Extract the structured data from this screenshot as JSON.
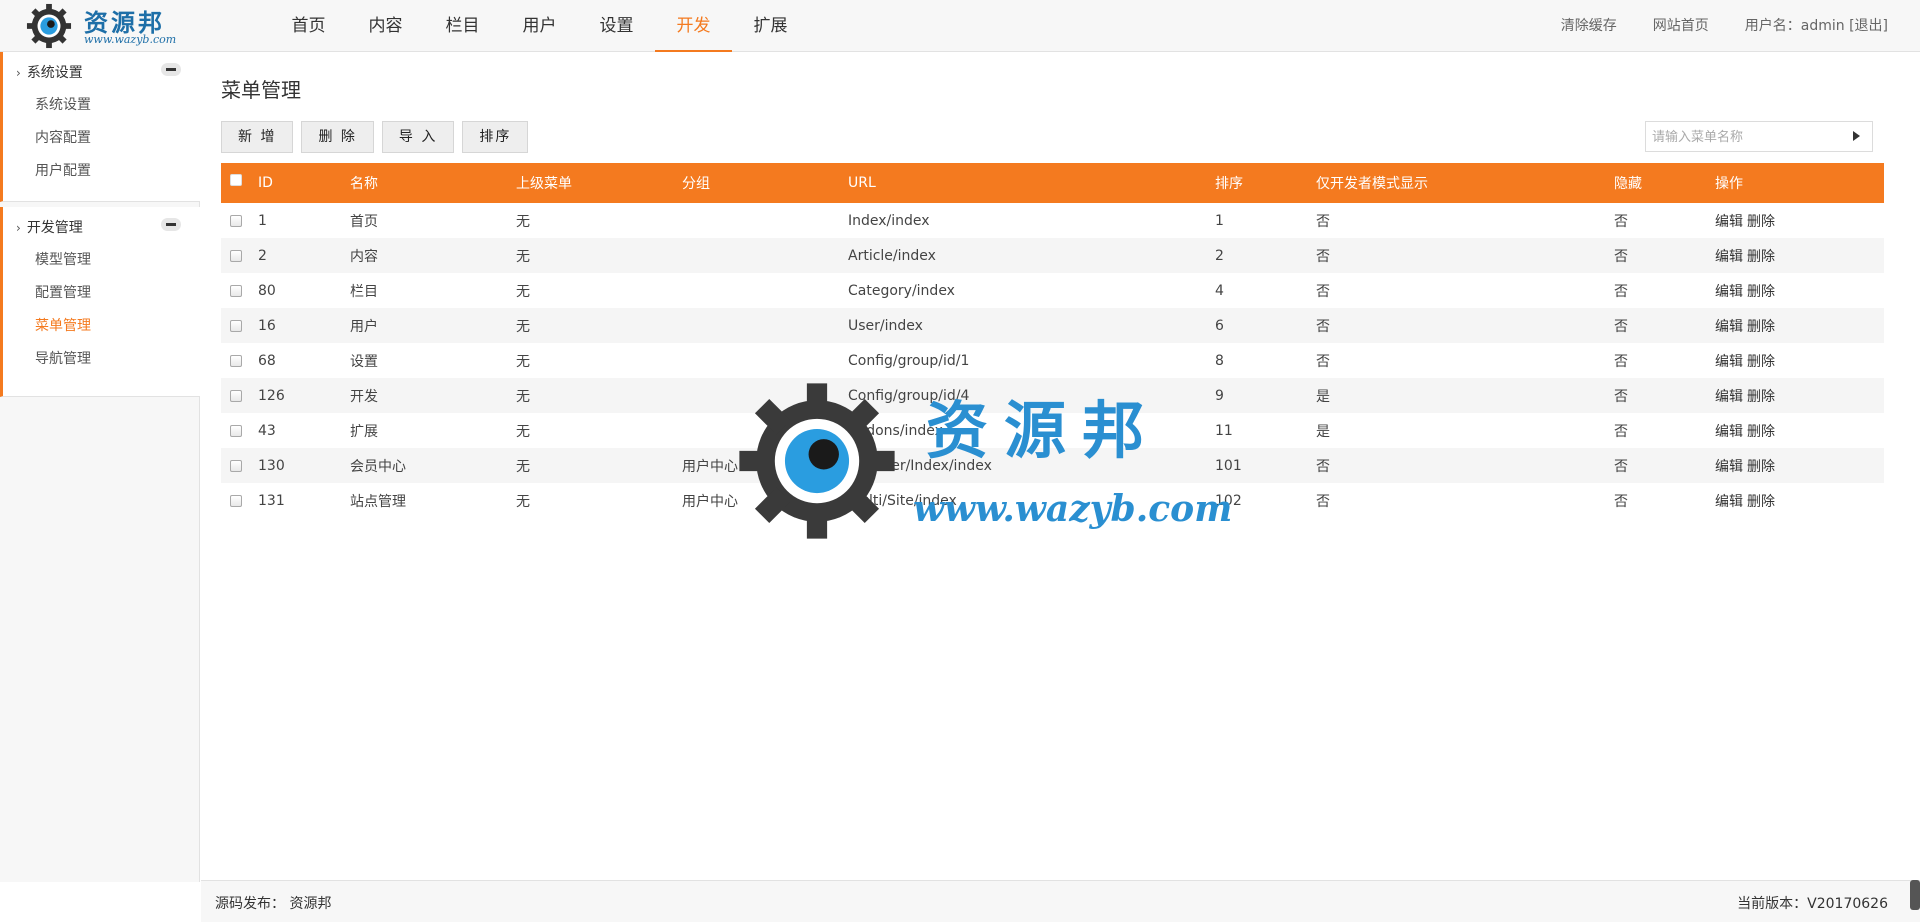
{
  "brand": {
    "name": "资源邦",
    "url": "www.wazyb.com"
  },
  "topnav": [
    {
      "label": "首页",
      "active": false
    },
    {
      "label": "内容",
      "active": false
    },
    {
      "label": "栏目",
      "active": false
    },
    {
      "label": "用户",
      "active": false
    },
    {
      "label": "设置",
      "active": false
    },
    {
      "label": "开发",
      "active": true
    },
    {
      "label": "扩展",
      "active": false
    }
  ],
  "topright": {
    "clear_cache": "清除缓存",
    "site_home": "网站首页",
    "user": "用户名：admin [退出]"
  },
  "sidebar": {
    "groups": [
      {
        "title": "系统设置",
        "items": [
          {
            "label": "系统设置",
            "active": false
          },
          {
            "label": "内容配置",
            "active": false
          },
          {
            "label": "用户配置",
            "active": false
          }
        ]
      },
      {
        "title": "开发管理",
        "items": [
          {
            "label": "模型管理",
            "active": false
          },
          {
            "label": "配置管理",
            "active": false
          },
          {
            "label": "菜单管理",
            "active": true
          },
          {
            "label": "导航管理",
            "active": false
          }
        ]
      }
    ]
  },
  "main": {
    "title": "菜单管理",
    "buttons": {
      "add": "新 增",
      "delete": "删 除",
      "import": "导 入",
      "sort": "排序"
    },
    "search": {
      "placeholder": "请输入菜单名称",
      "value": ""
    },
    "columns": [
      "ID",
      "名称",
      "上级菜单",
      "分组",
      "URL",
      "排序",
      "仅开发者模式显示",
      "隐藏",
      "操作"
    ],
    "rows": [
      {
        "id": "1",
        "name": "首页",
        "parent": "无",
        "group": "",
        "url": "Index/index",
        "sort": "1",
        "dev_only": "否",
        "hidden": "否"
      },
      {
        "id": "2",
        "name": "内容",
        "parent": "无",
        "group": "",
        "url": "Article/index",
        "sort": "2",
        "dev_only": "否",
        "hidden": "否"
      },
      {
        "id": "80",
        "name": "栏目",
        "parent": "无",
        "group": "",
        "url": "Category/index",
        "sort": "4",
        "dev_only": "否",
        "hidden": "否"
      },
      {
        "id": "16",
        "name": "用户",
        "parent": "无",
        "group": "",
        "url": "User/index",
        "sort": "6",
        "dev_only": "否",
        "hidden": "否"
      },
      {
        "id": "68",
        "name": "设置",
        "parent": "无",
        "group": "",
        "url": "Config/group/id/1",
        "sort": "8",
        "dev_only": "否",
        "hidden": "否"
      },
      {
        "id": "126",
        "name": "开发",
        "parent": "无",
        "group": "",
        "url": "Config/group/id/4",
        "sort": "9",
        "dev_only": "是",
        "hidden": "否"
      },
      {
        "id": "43",
        "name": "扩展",
        "parent": "无",
        "group": "",
        "url": "Addons/index",
        "sort": "11",
        "dev_only": "是",
        "hidden": "否"
      },
      {
        "id": "130",
        "name": "会员中心",
        "parent": "无",
        "group": "用户中心",
        "url": "Member/Index/index",
        "sort": "101",
        "dev_only": "否",
        "hidden": "否"
      },
      {
        "id": "131",
        "name": "站点管理",
        "parent": "无",
        "group": "用户中心",
        "url": "Multi/Site/index",
        "sort": "102",
        "dev_only": "否",
        "hidden": "否"
      }
    ],
    "actions": {
      "edit": "编辑",
      "delete": "删除"
    }
  },
  "footer": {
    "left": "源码发布：  资源邦",
    "right": "当前版本：V20170626"
  },
  "colors": {
    "accent": "#f47a1f",
    "brand": "#2a8fd1"
  }
}
